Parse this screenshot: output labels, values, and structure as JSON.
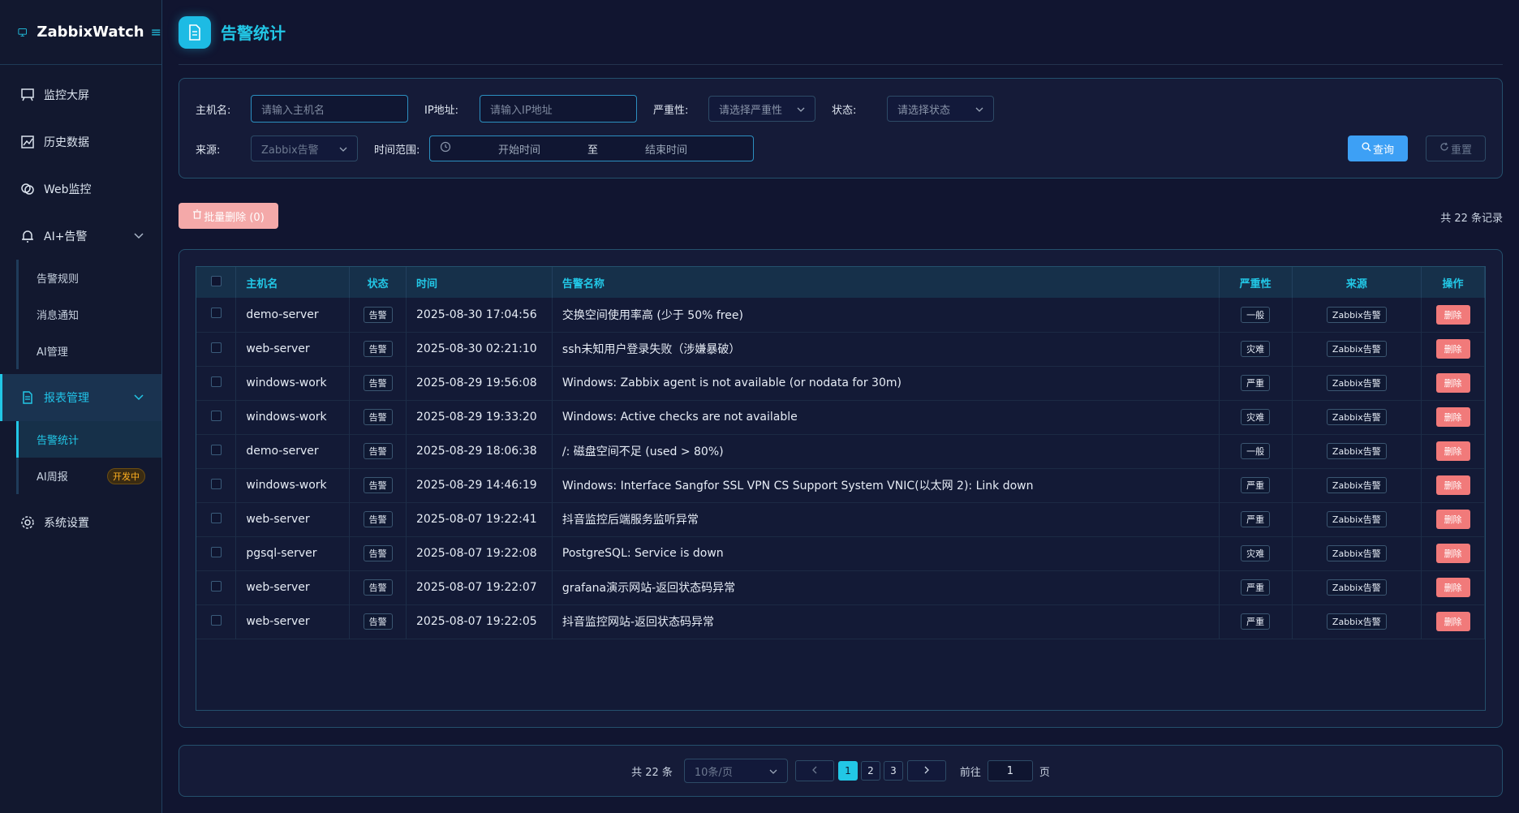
{
  "app": {
    "name": "ZabbixWatch",
    "menu_toggle": "≡"
  },
  "sidebar": {
    "items": [
      {
        "label": "监控大屏",
        "icon": "monitor-board-icon"
      },
      {
        "label": "历史数据",
        "icon": "chart-icon"
      },
      {
        "label": "Web监控",
        "icon": "globe-icon"
      },
      {
        "label": "AI+告警",
        "icon": "bell-icon"
      }
    ],
    "alert_sub": [
      {
        "label": "告警规则"
      },
      {
        "label": "消息通知"
      },
      {
        "label": "AI管理"
      }
    ],
    "report": {
      "label": "报表管理",
      "icon": "document-icon"
    },
    "report_sub": [
      {
        "label": "告警统计"
      },
      {
        "label": "AI周报",
        "badge": "开发中"
      }
    ],
    "settings": {
      "label": "系统设置",
      "icon": "gear-icon"
    }
  },
  "page": {
    "title": "告警统计"
  },
  "filters": {
    "host_label": "主机名:",
    "host_placeholder": "请输入主机名",
    "ip_label": "IP地址:",
    "ip_placeholder": "请输入IP地址",
    "severity_label": "严重性:",
    "severity_placeholder": "请选择严重性",
    "status_label": "状态:",
    "status_placeholder": "请选择状态",
    "source_label": "来源:",
    "source_value": "Zabbix告警",
    "time_label": "时间范围:",
    "start_placeholder": "开始时间",
    "to": "至",
    "end_placeholder": "结束时间",
    "query": "查询",
    "reset": "重置"
  },
  "toolbar": {
    "batch_delete": "批量删除 (0)",
    "total": "共 22 条记录"
  },
  "table": {
    "headers": {
      "host": "主机名",
      "status": "状态",
      "time": "时间",
      "name": "告警名称",
      "severity": "严重性",
      "source": "来源",
      "action": "操作"
    },
    "rows": [
      {
        "host": "demo-server",
        "status": "告警",
        "time": "2025-08-30 17:04:56",
        "name": "交换空间使用率高 (少于 50% free)",
        "severity": "一般",
        "source": "Zabbix告警",
        "action": "删除"
      },
      {
        "host": "web-server",
        "status": "告警",
        "time": "2025-08-30 02:21:10",
        "name": "ssh未知用户登录失败（涉嫌暴破）",
        "severity": "灾难",
        "source": "Zabbix告警",
        "action": "删除"
      },
      {
        "host": "windows-work",
        "status": "告警",
        "time": "2025-08-29 19:56:08",
        "name": "Windows: Zabbix agent is not available (or nodata for 30m)",
        "severity": "严重",
        "source": "Zabbix告警",
        "action": "删除"
      },
      {
        "host": "windows-work",
        "status": "告警",
        "time": "2025-08-29 19:33:20",
        "name": "Windows: Active checks are not available",
        "severity": "灾难",
        "source": "Zabbix告警",
        "action": "删除"
      },
      {
        "host": "demo-server",
        "status": "告警",
        "time": "2025-08-29 18:06:38",
        "name": "/: 磁盘空间不足 (used > 80%)",
        "severity": "一般",
        "source": "Zabbix告警",
        "action": "删除"
      },
      {
        "host": "windows-work",
        "status": "告警",
        "time": "2025-08-29 14:46:19",
        "name": "Windows: Interface Sangfor SSL VPN CS Support System VNIC(以太网 2): Link down",
        "severity": "严重",
        "source": "Zabbix告警",
        "action": "删除"
      },
      {
        "host": "web-server",
        "status": "告警",
        "time": "2025-08-07 19:22:41",
        "name": "抖音监控后端服务监听异常",
        "severity": "严重",
        "source": "Zabbix告警",
        "action": "删除"
      },
      {
        "host": "pgsql-server",
        "status": "告警",
        "time": "2025-08-07 19:22:08",
        "name": "PostgreSQL: Service is down",
        "severity": "灾难",
        "source": "Zabbix告警",
        "action": "删除"
      },
      {
        "host": "web-server",
        "status": "告警",
        "time": "2025-08-07 19:22:07",
        "name": "grafana演示网站-返回状态码异常",
        "severity": "严重",
        "source": "Zabbix告警",
        "action": "删除"
      },
      {
        "host": "web-server",
        "status": "告警",
        "time": "2025-08-07 19:22:05",
        "name": "抖音监控网站-返回状态码异常",
        "severity": "严重",
        "source": "Zabbix告警",
        "action": "删除"
      }
    ]
  },
  "pagination": {
    "total": "共 22 条",
    "page_size": "10条/页",
    "pages": [
      "1",
      "2",
      "3"
    ],
    "current": "1",
    "goto_label": "前往",
    "goto_value": "1",
    "page_suffix": "页"
  }
}
